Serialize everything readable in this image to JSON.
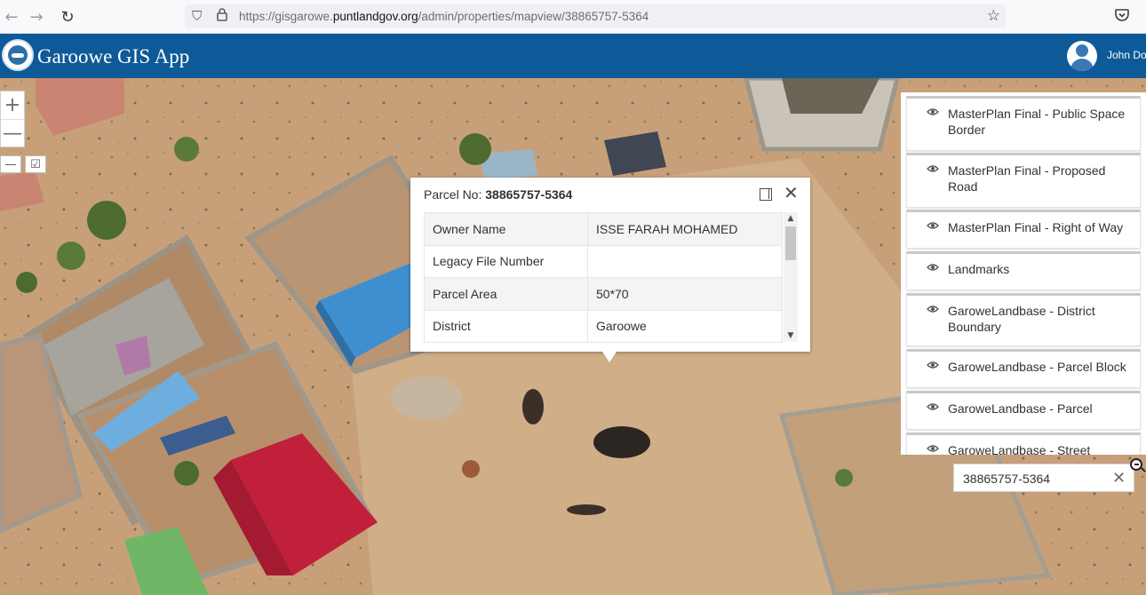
{
  "browser": {
    "url_prefix": "https://gisgarowe.",
    "url_domain": "puntlandgov.org",
    "url_path": "/admin/properties/mapview/38865757-5364",
    "icons": {
      "back": "arrow-left-icon",
      "forward": "arrow-right-icon",
      "reload": "reload-icon",
      "shield": "shield-icon",
      "lock": "lock-icon",
      "bookmark": "star-icon",
      "pocket": "pocket-icon"
    }
  },
  "app": {
    "title": "Garoowe GIS App",
    "user_name": "John Doe",
    "header_color": "#0e5a98"
  },
  "map_controls": {
    "zoom_in": "+",
    "zoom_out": "—",
    "tool_1": "—",
    "tool_2": "☑"
  },
  "popup": {
    "title_prefix": "Parcel No: ",
    "parcel_no": "38865757-5364",
    "rows": [
      {
        "key": "Owner Name",
        "value": "ISSE FARAH MOHAMED"
      },
      {
        "key": "Legacy File Number",
        "value": ""
      },
      {
        "key": "Parcel Area",
        "value": "50*70"
      },
      {
        "key": "District",
        "value": "Garoowe"
      }
    ]
  },
  "layers": {
    "items": [
      {
        "label": "MasterPlan Final - Public Space Border"
      },
      {
        "label": "MasterPlan Final - Proposed Road"
      },
      {
        "label": "MasterPlan Final - Right of Way"
      },
      {
        "label": "Landmarks"
      },
      {
        "label": "GaroweLandbase - District Boundary"
      },
      {
        "label": "GaroweLandbase - Parcel Block"
      },
      {
        "label": "GaroweLandbase - Parcel"
      },
      {
        "label": "GaroweLandbase - Street"
      }
    ]
  },
  "search": {
    "value": "38865757-5364"
  }
}
